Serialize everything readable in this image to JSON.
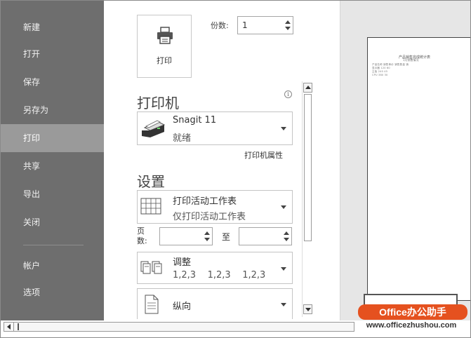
{
  "nav": {
    "items": [
      {
        "label": "新建"
      },
      {
        "label": "打开"
      },
      {
        "label": "保存"
      },
      {
        "label": "另存为"
      },
      {
        "label": "打印"
      },
      {
        "label": "共享"
      },
      {
        "label": "导出"
      },
      {
        "label": "关闭"
      },
      {
        "label": "帐户"
      },
      {
        "label": "选项"
      }
    ],
    "active": "打印"
  },
  "print": {
    "button_label": "打印",
    "copies_label": "份数:",
    "copies_value": "1"
  },
  "printer": {
    "heading": "打印机",
    "name": "Snagit 11",
    "status": "就绪",
    "properties_link": "打印机属性"
  },
  "settings": {
    "heading": "设置",
    "scope_title": "打印活动工作表",
    "scope_desc": "仅打印活动工作表",
    "pages_label": "页\n数:",
    "to_label": "至",
    "collate_title": "调整",
    "collate_desc": "1,2,3    1,2,3    1,2,3",
    "orientation": "纵向"
  },
  "preview": {
    "title": "产品销售完成统计表",
    "subtitle": "1月销售情况",
    "rows": [
      "产品名称    销售单价    销售数量    销",
      "显示器      120        60         ",
      "主板        240        45         ",
      "CPU         380        30         "
    ]
  },
  "watermark": {
    "badge": "Office办公助手",
    "url": "www.officezhushou.com"
  },
  "colors": {
    "nav_bg": "#6e6e6e",
    "nav_active": "#9a9a9a",
    "watermark": "#e5511f"
  }
}
